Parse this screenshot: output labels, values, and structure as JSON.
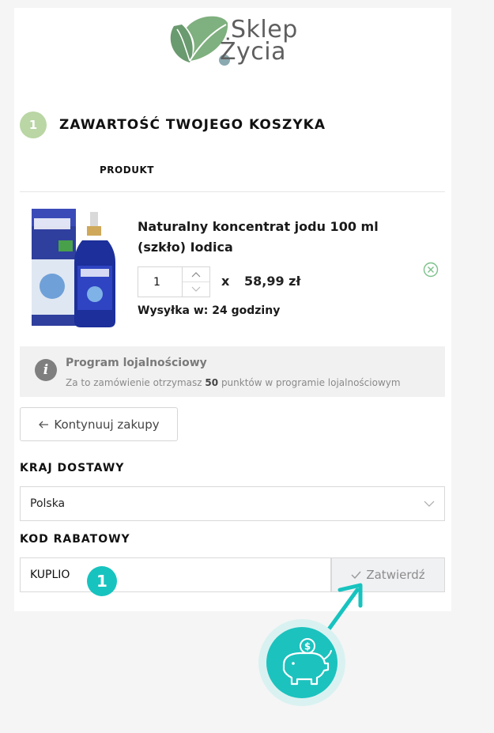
{
  "logo": {
    "line1": "Sklep",
    "line2": "Życia"
  },
  "step": {
    "number": "1",
    "title": "ZAWARTOŚĆ TWOJEGO KOSZYKA"
  },
  "table": {
    "column_product": "PRODUKT"
  },
  "item": {
    "name": "Naturalny koncentrat jodu 100 ml (szkło) Iodica",
    "quantity": "1",
    "times": "x",
    "price": "58,99 zł",
    "shipping": "Wysyłka w: 24 godziny"
  },
  "loyalty": {
    "title": "Program lojalnościowy",
    "text_before": "Za to zamówienie otrzymasz",
    "points": "50",
    "text_after": "punktów w programie lojalnościowym"
  },
  "continue": {
    "label": "Kontynuuj zakupy"
  },
  "country": {
    "label": "KRAJ DOSTAWY",
    "selected": "Polska"
  },
  "coupon": {
    "label": "KOD RABATOWY",
    "value": "KUPLIO",
    "apply_label": "Zatwierdź",
    "badge": "1"
  },
  "colors": {
    "accent": "#17c3bf",
    "step_circle": "#b9d6a4",
    "logo_green": "#5a9b63"
  }
}
